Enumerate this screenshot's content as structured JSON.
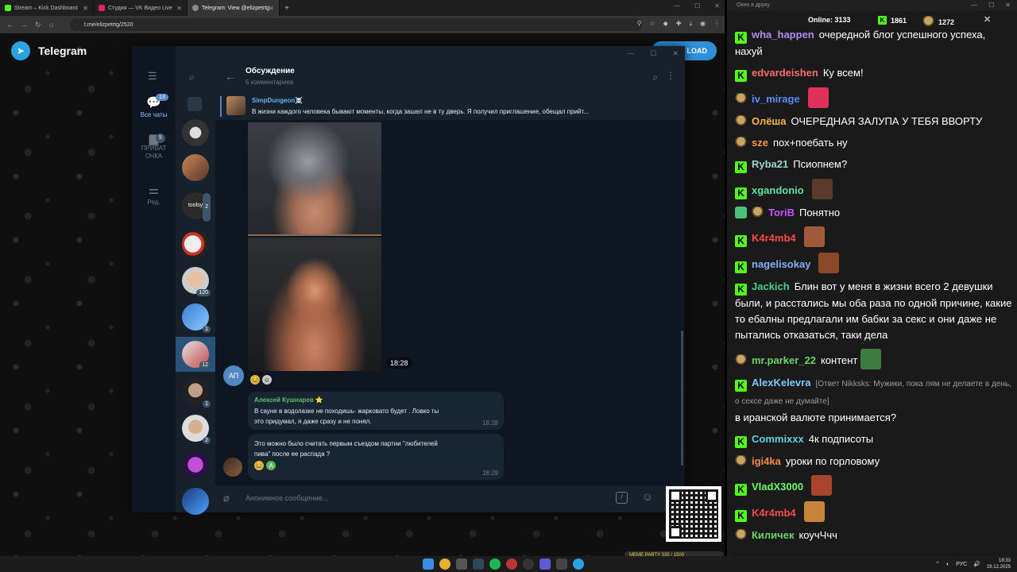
{
  "browser": {
    "tabs": [
      {
        "title": "Stream – Kick Dashboard",
        "color": "#53fc18"
      },
      {
        "title": "Студия — VK Видео Live",
        "color": "#e0245e"
      },
      {
        "title": "Telegram: View @elizpetrtg",
        "color": "#8a8a8a"
      }
    ],
    "url": "t.me/elizpetrtg/2520"
  },
  "telegram_page": {
    "brand": "Telegram",
    "download_label": "LOAD"
  },
  "tg": {
    "folders": [
      {
        "label": "Все чаты",
        "badge": "13"
      },
      {
        "label": "ПРИВАТ ОЧКА",
        "badge": "5"
      },
      {
        "label": "Ред.",
        "badge": ""
      }
    ],
    "chat_badges": [
      "",
      "",
      "",
      "2",
      "",
      "120",
      "1",
      "12",
      "1",
      "2",
      ""
    ],
    "chat_text": "toolsy",
    "header": {
      "title": "Обсуждение",
      "subtitle": "5 комментариев"
    },
    "pinned": {
      "name": "SimpDungeon☠️",
      "text": "В жизни каждого человека бывают моменты, когда зашел не в ту дверь. Я получил приглашение, обещал прийт..."
    },
    "image_time": "18:28",
    "avatar_initials": "АП",
    "messages": [
      {
        "author": "Алексей Кушнарев ⭐",
        "text": "В сауне в водолазке не походишь- жарковато будет . Ловко ты это придумал, я даже сразу и не понял.",
        "time": "18:28"
      },
      {
        "author": "",
        "text": "Это можно было считать первым съездом партии \"любителей пива\" после ее распада ?",
        "time": "18:29"
      }
    ],
    "compose_placeholder": "Анонимное сообщение..."
  },
  "overlay": {
    "meme": "MEME PARTY 335 / 1500"
  },
  "taskbar": {
    "lang": "РУС",
    "time": "18:33",
    "date": "29.12.2025"
  },
  "chat_panel": {
    "title": "Окно в друку",
    "online_label": "Online:",
    "online_count": "3133",
    "kick_count": "1861",
    "other_count": "1272",
    "messages": [
      {
        "badge": "k",
        "user": "wha_happen",
        "color": "#b18cf5",
        "text": "очередной блог успешного успеха, нахуй",
        "emote": ""
      },
      {
        "badge": "k",
        "user": "edvardeishen",
        "color": "#ff6b6b",
        "text": "Ку всем!",
        "emote": ""
      },
      {
        "badge": "p",
        "user": "iv_mirage",
        "color": "#5a8cff",
        "text": "",
        "emote": "#e0315d"
      },
      {
        "badge": "p",
        "user": "Олёша",
        "color": "#ffb347",
        "text": "ОЧЕРЕДНАЯ ЗАЛУПА У ТЕБЯ ВВОРТУ",
        "emote": ""
      },
      {
        "badge": "p",
        "user": "sze",
        "color": "#ff9a3c",
        "text": "пох+поебать ну",
        "emote": ""
      },
      {
        "badge": "k",
        "user": "Ryba21",
        "color": "#9bd6c8",
        "text": "Псиопнем?",
        "emote": ""
      },
      {
        "badge": "k",
        "user": "xgandonio",
        "color": "#5fe0a8",
        "text": "",
        "emote": "#5a3a2a"
      },
      {
        "badge": "sp",
        "user": "ToriB",
        "color": "#c257ff",
        "text": "Понятно",
        "emote": ""
      },
      {
        "badge": "k",
        "user": "K4r4mb4",
        "color": "#ff4b4b",
        "text": "",
        "emote": "#a05a3a"
      },
      {
        "badge": "k",
        "user": "nagelisokay",
        "color": "#7fb0ff",
        "text": "",
        "emote": "#8a4a2a"
      },
      {
        "badge": "k",
        "user": "Jackich",
        "color": "#48d08a",
        "text": "Блин вот у меня в жизни всего 2 девушки были, и расстались мы оба раза по одной причине, какие то ебалны предлагали им бабки за секс и они даже не пытались отказаться, таки дела",
        "emote": ""
      },
      {
        "badge": "p",
        "user": "mr.parker_22",
        "color": "#6bd26b",
        "text": "контент",
        "emote": "#3e7b3e"
      },
      {
        "badge": "k",
        "user": "AlexKelevra",
        "color": "#80c8ff",
        "reply": "[Ответ Nikksks: Мужики, пока лям не делаете в день, о сексе даже не думайте]",
        "text": "в иранской валюте принимается?",
        "emote": ""
      },
      {
        "badge": "k",
        "user": "Commixxx",
        "color": "#5fd0e0",
        "text": "4к подписоты",
        "emote": ""
      },
      {
        "badge": "p",
        "user": "igi4ka",
        "color": "#ff8a4a",
        "text": "уроки по горловому",
        "emote": ""
      },
      {
        "badge": "k",
        "user": "VladX3000",
        "color": "#63ff6b",
        "text": "",
        "emote": "#a8442e"
      },
      {
        "badge": "k",
        "user": "K4r4mb4",
        "color": "#ff4b4b",
        "text": "",
        "emote": "#c8843a"
      },
      {
        "badge": "p",
        "user": "Киличек",
        "color": "#6bd26b",
        "text": "коучЧчч",
        "emote": ""
      }
    ]
  }
}
